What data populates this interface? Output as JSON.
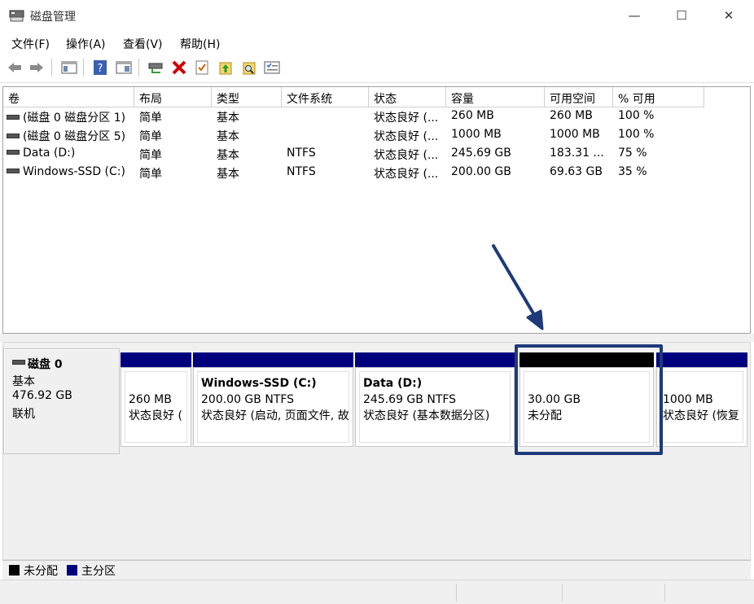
{
  "window": {
    "title": "磁盘管理",
    "minimize_glyph": "—",
    "maximize_glyph": "☐",
    "close_glyph": "✕"
  },
  "menu": {
    "items": [
      {
        "label": "文件(F)"
      },
      {
        "label": "操作(A)"
      },
      {
        "label": "查看(V)"
      },
      {
        "label": "帮助(H)"
      }
    ]
  },
  "toolbar": {
    "icons": [
      "back-icon",
      "forward-icon",
      "console-tree-icon",
      "help-icon",
      "properties-icon",
      "connect-drive-icon",
      "delete-icon",
      "check-icon",
      "up-arrow-icon",
      "search-icon",
      "list-icon"
    ]
  },
  "volume_table": {
    "columns": [
      "卷",
      "布局",
      "类型",
      "文件系统",
      "状态",
      "容量",
      "可用空间",
      "% 可用"
    ],
    "rows": [
      [
        "(磁盘 0 磁盘分区 1)",
        "简单",
        "基本",
        "",
        "状态良好 (...",
        "260 MB",
        "260 MB",
        "100 %"
      ],
      [
        "(磁盘 0 磁盘分区 5)",
        "简单",
        "基本",
        "",
        "状态良好 (...",
        "1000 MB",
        "1000 MB",
        "100 %"
      ],
      [
        "Data (D:)",
        "简单",
        "基本",
        "NTFS",
        "状态良好 (...",
        "245.69 GB",
        "183.31 ...",
        "75 %"
      ],
      [
        "Windows-SSD (C:)",
        "简单",
        "基本",
        "NTFS",
        "状态良好 (...",
        "200.00 GB",
        "69.63 GB",
        "35 %"
      ]
    ]
  },
  "disk": {
    "name": "磁盘 0",
    "type": "基本",
    "size": "476.92 GB",
    "state": "联机",
    "partitions": [
      {
        "name": "",
        "line1": "260 MB",
        "line2": "状态良好 (",
        "color": "#00007f"
      },
      {
        "name": "Windows-SSD  (C:)",
        "line1": "200.00 GB NTFS",
        "line2": "状态良好 (启动, 页面文件, 故",
        "color": "#00007f"
      },
      {
        "name": "Data  (D:)",
        "line1": "245.69 GB NTFS",
        "line2": "状态良好 (基本数据分区)",
        "color": "#00007f"
      },
      {
        "name": "",
        "line1": "30.00 GB",
        "line2": "未分配",
        "color": "#000000"
      },
      {
        "name": "",
        "line1": "1000 MB",
        "line2": "状态良好 (恢复",
        "color": "#00007f"
      }
    ]
  },
  "legend": {
    "items": [
      {
        "label": "未分配",
        "color": "#000000"
      },
      {
        "label": "主分区",
        "color": "#00007f"
      }
    ]
  },
  "colors": {
    "primary_partition": "#00007f",
    "unallocated": "#000000",
    "highlight": "#1f3a7a"
  }
}
